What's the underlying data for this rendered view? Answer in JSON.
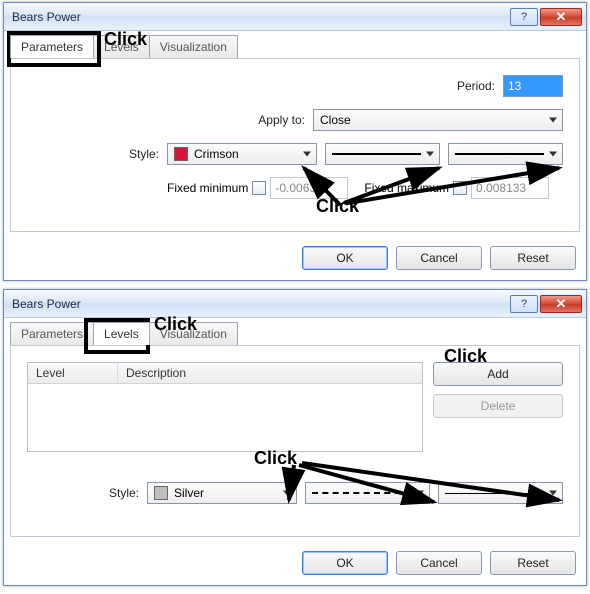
{
  "dialog1": {
    "title": "Bears Power",
    "tabs": {
      "parameters": "Parameters",
      "levels": "Levels",
      "visualization": "Visualization",
      "active": 0
    },
    "fields": {
      "period_label": "Period:",
      "period_value": "13",
      "apply_label": "Apply to:",
      "apply_value": "Close",
      "style_label": "Style:",
      "style_color_name": "Crimson",
      "style_color_hex": "#DC143C",
      "fixed_min_label": "Fixed minimum",
      "fixed_min_value": "-0.006392",
      "fixed_max_label": "Fixed maximum",
      "fixed_max_value": "0.008133"
    },
    "buttons": {
      "ok": "OK",
      "cancel": "Cancel",
      "reset": "Reset"
    },
    "annotations": {
      "tab_click": "Click",
      "dropdown_click": "Click"
    }
  },
  "dialog2": {
    "title": "Bears Power",
    "tabs": {
      "parameters": "Parameters",
      "levels": "Levels",
      "visualization": "Visualization",
      "active": 1
    },
    "list": {
      "col_level": "Level",
      "col_desc": "Description"
    },
    "side": {
      "add": "Add",
      "delete": "Delete"
    },
    "fields": {
      "style_label": "Style:",
      "style_color_name": "Silver",
      "style_color_hex": "#C0C0C0"
    },
    "buttons": {
      "ok": "OK",
      "cancel": "Cancel",
      "reset": "Reset"
    },
    "annotations": {
      "tab_click": "Click",
      "add_click": "Click",
      "dropdown_click": "Click"
    }
  }
}
